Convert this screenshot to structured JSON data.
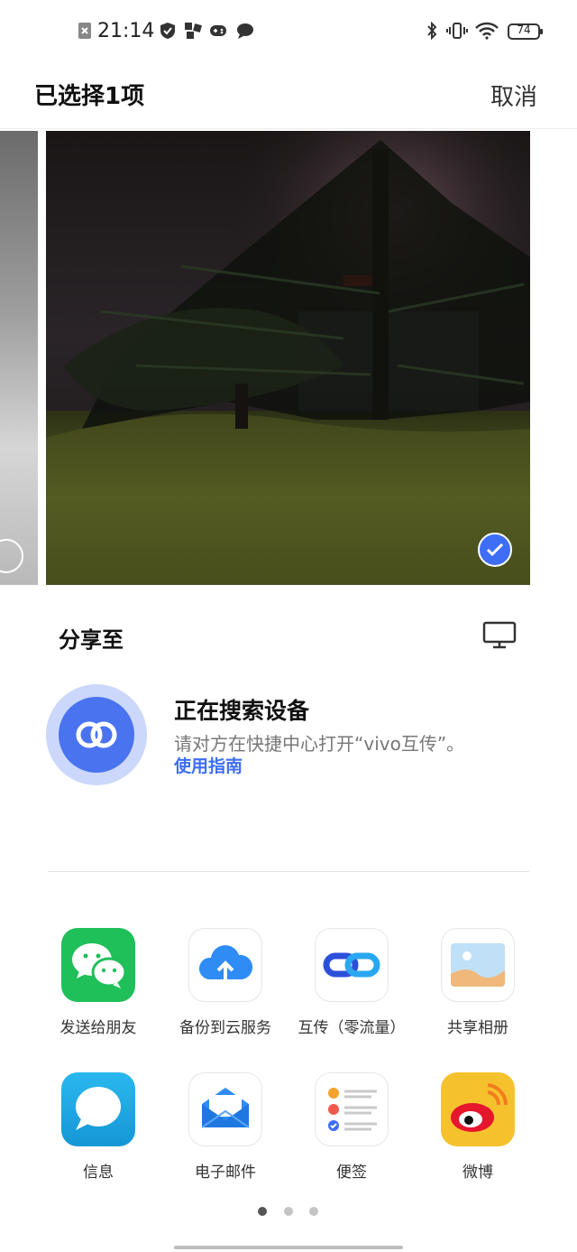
{
  "status_bar": {
    "time": "21:14",
    "battery": "74"
  },
  "header": {
    "title": "已选择1项",
    "cancel_label": "取消"
  },
  "share": {
    "label": "分享至"
  },
  "device_search": {
    "title": "正在搜索设备",
    "description": "请对方在快捷中心打开“vivo互传”。",
    "guide_link": "使用指南"
  },
  "apps": [
    {
      "label": "发送给朋友",
      "icon": "wechat-icon"
    },
    {
      "label": "备份到云服务",
      "icon": "cloud-upload-icon"
    },
    {
      "label": "互传（零流量）",
      "icon": "link-icon"
    },
    {
      "label": "共享相册",
      "icon": "photo-album-icon"
    },
    {
      "label": "信息",
      "icon": "message-icon"
    },
    {
      "label": "电子邮件",
      "icon": "email-icon"
    },
    {
      "label": "便签",
      "icon": "notes-icon"
    },
    {
      "label": "微博",
      "icon": "weibo-icon"
    }
  ],
  "pagination": {
    "pages": 3,
    "current": 1
  },
  "colors": {
    "accent": "#3d6ef5",
    "wechat": "#1fbf5a",
    "weibo": "#f5c22e"
  }
}
